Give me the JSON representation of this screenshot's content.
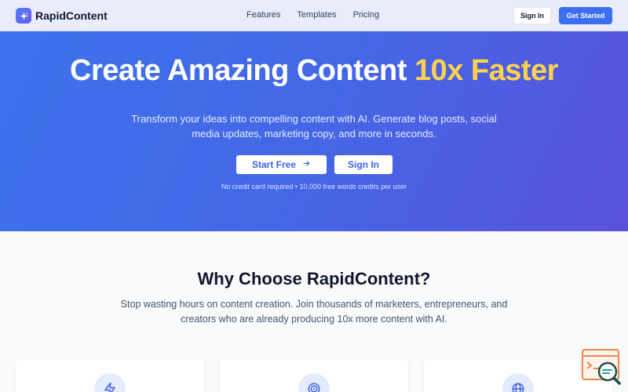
{
  "nav": {
    "brand": "RapidContent",
    "links": [
      "Features",
      "Templates",
      "Pricing"
    ],
    "sign_in": "Sign In",
    "get_started": "Get Started"
  },
  "hero": {
    "title_main": "Create Amazing Content ",
    "title_accent": "10x Faster",
    "subtitle": "Transform your ideas into compelling content with AI. Generate blog posts, social media updates, marketing copy, and more in seconds.",
    "start_free": "Start Free",
    "sign_in": "Sign In",
    "note": "No credit card required • 10,000 free words credits per user"
  },
  "why": {
    "title": "Why Choose RapidContent?",
    "subtitle": "Stop wasting hours on content creation. Join thousands of marketers, entrepreneurs, and creators who are already producing 10x more content with AI."
  },
  "features": [
    {
      "icon": "lightning-icon"
    },
    {
      "icon": "target-icon"
    },
    {
      "icon": "globe-icon"
    }
  ],
  "colors": {
    "accent": "#fcd34d",
    "primary": "#3b6ff0",
    "hero_gradient_start": "#3d72ec",
    "hero_gradient_end": "#5a52dc"
  }
}
